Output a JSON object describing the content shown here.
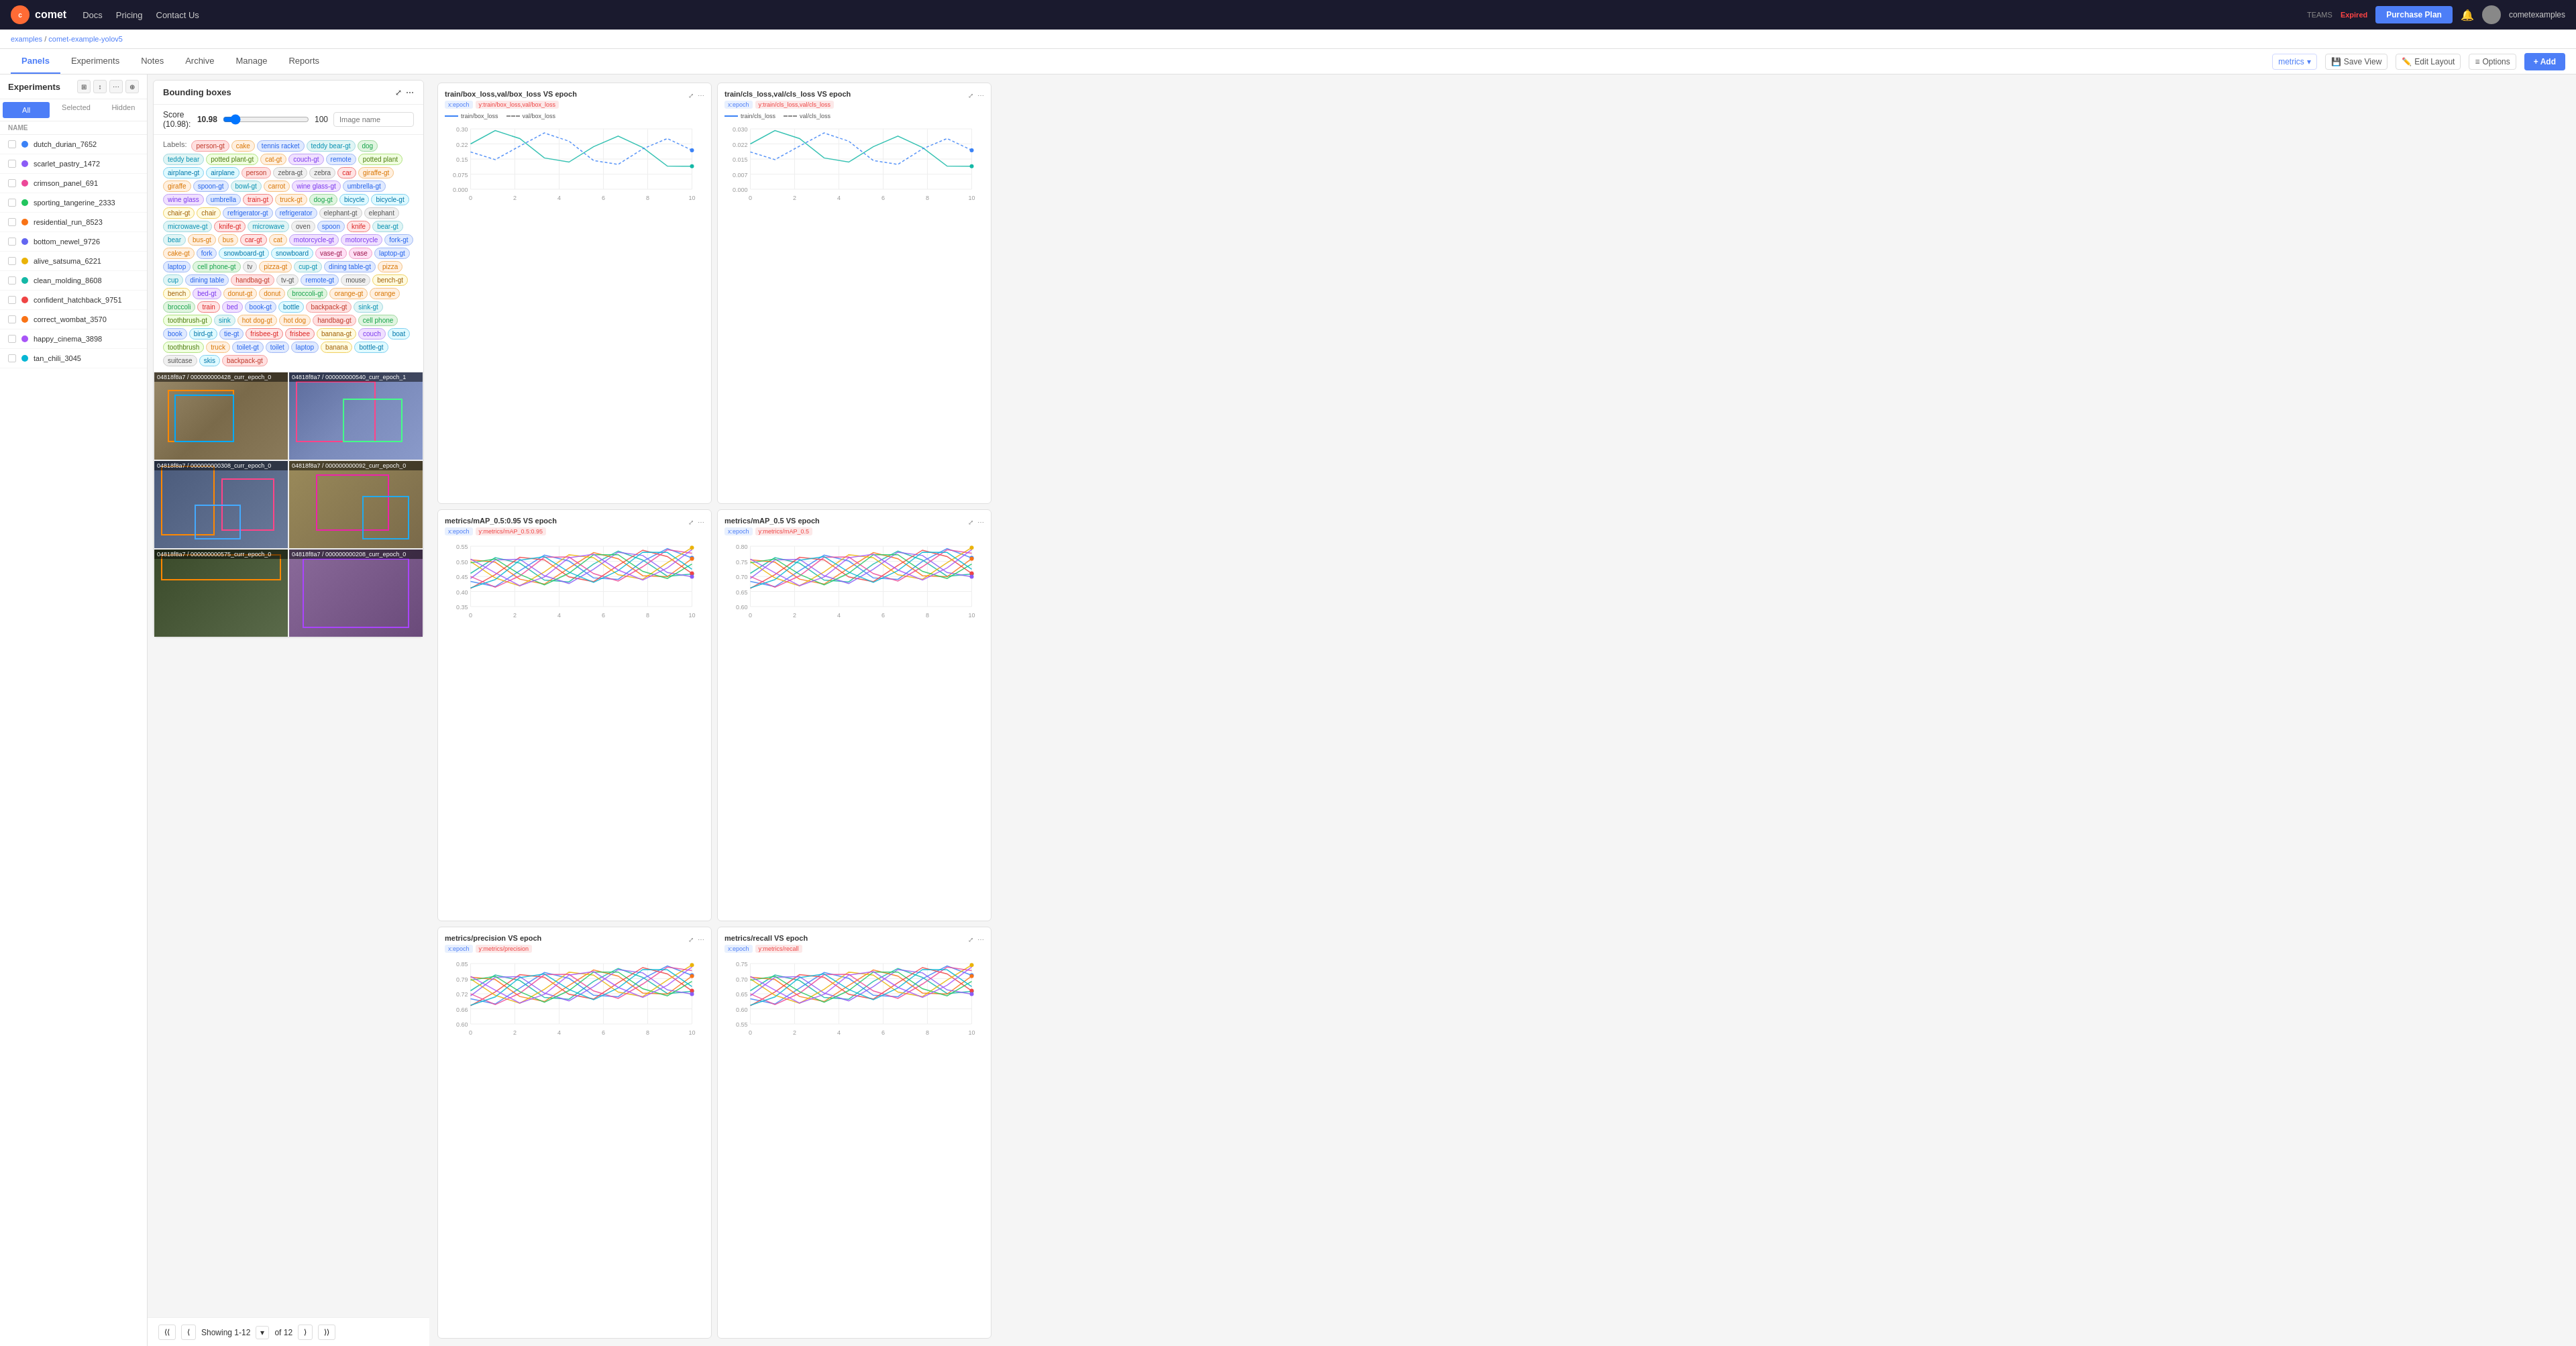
{
  "navbar": {
    "logo": "comet",
    "links": [
      "Docs",
      "Pricing",
      "Contact Us"
    ],
    "teams_label": "TEAMS",
    "expired": "Expired",
    "purchase_btn": "Purchase Plan",
    "user": "cometexamples"
  },
  "breadcrumb": {
    "parent": "examples",
    "child": "comet-example-yolov5"
  },
  "tabs": {
    "items": [
      "Panels",
      "Experiments",
      "Notes",
      "Archive",
      "Manage",
      "Reports"
    ],
    "active": "Panels"
  },
  "toolbar": {
    "metrics": "metrics",
    "save_view": "Save View",
    "edit_layout": "Edit Layout",
    "options": "Options",
    "add": "+ Add"
  },
  "sidebar": {
    "title": "Experiments",
    "filter_tabs": [
      "All",
      "Selected",
      "Hidden"
    ],
    "active_filter": "All",
    "col_header": "NAME",
    "experiments": [
      {
        "name": "dutch_durian_7652",
        "color": "#3b82f6"
      },
      {
        "name": "scarlet_pastry_1472",
        "color": "#8b5cf6"
      },
      {
        "name": "crimson_panel_691",
        "color": "#ec4899"
      },
      {
        "name": "sporting_tangerine_2333",
        "color": "#22c55e"
      },
      {
        "name": "residential_run_8523",
        "color": "#f97316"
      },
      {
        "name": "bottom_newel_9726",
        "color": "#6366f1"
      },
      {
        "name": "alive_satsuma_6221",
        "color": "#eab308"
      },
      {
        "name": "clean_molding_8608",
        "color": "#14b8a6"
      },
      {
        "name": "confident_hatchback_9751",
        "color": "#ef4444"
      },
      {
        "name": "correct_wombat_3570",
        "color": "#f97316"
      },
      {
        "name": "happy_cinema_3898",
        "color": "#a855f7"
      },
      {
        "name": "tan_chili_3045",
        "color": "#06b6d4"
      }
    ]
  },
  "bb_panel": {
    "title": "Bounding boxes",
    "score_label": "Score (10.98):",
    "score_value": "10.98",
    "score_max": "100",
    "image_name_placeholder": "Image name",
    "labels": [
      {
        "text": "person-gt",
        "style": "pink"
      },
      {
        "text": "cake",
        "style": "orange"
      },
      {
        "text": "tennis racket",
        "style": "blue"
      },
      {
        "text": "teddy bear-gt",
        "style": "teal"
      },
      {
        "text": "dog",
        "style": "green"
      },
      {
        "text": "teddy bear",
        "style": "teal"
      },
      {
        "text": "potted plant-gt",
        "style": "lime"
      },
      {
        "text": "cat-gt",
        "style": "orange"
      },
      {
        "text": "couch-gt",
        "style": "purple"
      },
      {
        "text": "remote",
        "style": "blue"
      },
      {
        "text": "potted plant",
        "style": "lime"
      },
      {
        "text": "airplane-gt",
        "style": "cyan"
      },
      {
        "text": "airplane",
        "style": "cyan"
      },
      {
        "text": "person",
        "style": "pink"
      },
      {
        "text": "zebra-gt",
        "style": "gray"
      },
      {
        "text": "zebra",
        "style": "gray"
      },
      {
        "text": "car",
        "style": "red"
      },
      {
        "text": "giraffe-gt",
        "style": "orange"
      },
      {
        "text": "giraffe",
        "style": "orange"
      },
      {
        "text": "spoon-gt",
        "style": "blue"
      },
      {
        "text": "bowl-gt",
        "style": "teal"
      },
      {
        "text": "carrot",
        "style": "orange"
      },
      {
        "text": "wine glass-gt",
        "style": "purple"
      },
      {
        "text": "umbrella-gt",
        "style": "blue"
      },
      {
        "text": "wine glass",
        "style": "purple"
      },
      {
        "text": "umbrella",
        "style": "blue"
      },
      {
        "text": "train-gt",
        "style": "red"
      },
      {
        "text": "truck-gt",
        "style": "orange"
      },
      {
        "text": "dog-gt",
        "style": "green"
      },
      {
        "text": "bicycle",
        "style": "cyan"
      },
      {
        "text": "bicycle-gt",
        "style": "cyan"
      },
      {
        "text": "chair-gt",
        "style": "yellow"
      },
      {
        "text": "chair",
        "style": "yellow"
      },
      {
        "text": "refrigerator-gt",
        "style": "blue"
      },
      {
        "text": "refrigerator",
        "style": "blue"
      },
      {
        "text": "elephant-gt",
        "style": "gray"
      },
      {
        "text": "elephant",
        "style": "gray"
      },
      {
        "text": "microwave-gt",
        "style": "teal"
      },
      {
        "text": "knife-gt",
        "style": "red"
      },
      {
        "text": "microwave",
        "style": "teal"
      },
      {
        "text": "oven",
        "style": "gray"
      },
      {
        "text": "spoon",
        "style": "blue"
      },
      {
        "text": "knife",
        "style": "red"
      },
      {
        "text": "bear-gt",
        "style": "teal"
      },
      {
        "text": "bear",
        "style": "teal"
      },
      {
        "text": "bus-gt",
        "style": "orange"
      },
      {
        "text": "bus",
        "style": "orange"
      },
      {
        "text": "car-gt",
        "style": "red"
      },
      {
        "text": "cat",
        "style": "orange"
      },
      {
        "text": "motorcycle-gt",
        "style": "purple"
      },
      {
        "text": "motorcycle",
        "style": "purple"
      },
      {
        "text": "fork-gt",
        "style": "blue"
      },
      {
        "text": "cake-gt",
        "style": "orange"
      },
      {
        "text": "fork",
        "style": "blue"
      },
      {
        "text": "snowboard-gt",
        "style": "cyan"
      },
      {
        "text": "snowboard",
        "style": "cyan"
      },
      {
        "text": "vase-gt",
        "style": "magenta"
      },
      {
        "text": "vase",
        "style": "magenta"
      },
      {
        "text": "laptop-gt",
        "style": "blue"
      },
      {
        "text": "laptop",
        "style": "blue"
      },
      {
        "text": "cell phone-gt",
        "style": "green"
      },
      {
        "text": "tv",
        "style": "gray"
      },
      {
        "text": "pizza-gt",
        "style": "orange"
      },
      {
        "text": "cup-gt",
        "style": "teal"
      },
      {
        "text": "dining table-gt",
        "style": "blue"
      },
      {
        "text": "pizza",
        "style": "orange"
      },
      {
        "text": "cup",
        "style": "teal"
      },
      {
        "text": "dining table",
        "style": "blue"
      },
      {
        "text": "handbag-gt",
        "style": "pink"
      },
      {
        "text": "tv-gt",
        "style": "gray"
      },
      {
        "text": "remote-gt",
        "style": "blue"
      },
      {
        "text": "mouse",
        "style": "gray"
      },
      {
        "text": "bench-gt",
        "style": "yellow"
      },
      {
        "text": "bench",
        "style": "yellow"
      },
      {
        "text": "bed-gt",
        "style": "purple"
      },
      {
        "text": "donut-gt",
        "style": "orange"
      },
      {
        "text": "donut",
        "style": "orange"
      },
      {
        "text": "broccoli-gt",
        "style": "green"
      },
      {
        "text": "orange-gt",
        "style": "orange"
      },
      {
        "text": "orange",
        "style": "orange"
      },
      {
        "text": "broccoli",
        "style": "green"
      },
      {
        "text": "train",
        "style": "red"
      },
      {
        "text": "bed",
        "style": "purple"
      },
      {
        "text": "book-gt",
        "style": "blue"
      },
      {
        "text": "bottle",
        "style": "cyan"
      },
      {
        "text": "backpack-gt",
        "style": "pink"
      },
      {
        "text": "sink-gt",
        "style": "teal"
      },
      {
        "text": "toothbrush-gt",
        "style": "lime"
      },
      {
        "text": "sink",
        "style": "teal"
      },
      {
        "text": "hot dog-gt",
        "style": "orange"
      },
      {
        "text": "hot dog",
        "style": "orange"
      },
      {
        "text": "handbag-gt",
        "style": "pink"
      },
      {
        "text": "cell phone",
        "style": "green"
      },
      {
        "text": "book",
        "style": "blue"
      },
      {
        "text": "bird-gt",
        "style": "cyan"
      },
      {
        "text": "tie-gt",
        "style": "blue"
      },
      {
        "text": "frisbee-gt",
        "style": "red"
      },
      {
        "text": "frisbee",
        "style": "red"
      },
      {
        "text": "banana-gt",
        "style": "yellow"
      },
      {
        "text": "couch",
        "style": "purple"
      },
      {
        "text": "boat",
        "style": "cyan"
      },
      {
        "text": "toothbrush",
        "style": "lime"
      },
      {
        "text": "truck",
        "style": "orange"
      },
      {
        "text": "toilet-gt",
        "style": "blue"
      },
      {
        "text": "toilet",
        "style": "blue"
      },
      {
        "text": "laptop",
        "style": "blue"
      },
      {
        "text": "banana",
        "style": "yellow"
      },
      {
        "text": "bottle-gt",
        "style": "cyan"
      },
      {
        "text": "suitcase",
        "style": "gray"
      },
      {
        "text": "skis",
        "style": "cyan"
      },
      {
        "text": "backpack-gt",
        "style": "pink"
      }
    ],
    "images": [
      {
        "id": "04818f8a7 / 000000000428_curr_epoch_0",
        "bg": "#7a8a6a"
      },
      {
        "id": "04818f8a7 / 000000000540_curr_epoch_1",
        "bg": "#6a7a8a"
      },
      {
        "id": "04818f8a7 / 000000000308_curr_epoch_0",
        "bg": "#5a6a7a"
      },
      {
        "id": "04818f8a7 / 000000000092_curr_epoch_0",
        "bg": "#8a7a5a"
      },
      {
        "id": "04818f8a7 / 000000000575_curr_epoch_0",
        "bg": "#6a8a7a"
      },
      {
        "id": "04818f8a7 / 000000000208_curr_epoch_0",
        "bg": "#7a6a8a"
      }
    ]
  },
  "charts": [
    {
      "title": "train/box_loss,val/box_loss VS epoch",
      "tags": [
        "x:epoch",
        "y:train/box_loss,val/box_loss"
      ],
      "legend": [
        {
          "label": "train/box_loss",
          "color": "#3b82f6",
          "dashed": false
        },
        {
          "label": "val/box_loss",
          "color": "#888",
          "dashed": true
        }
      ],
      "y_max": 0.3,
      "y_min": 0
    },
    {
      "title": "train/cls_loss,val/cls_loss VS epoch",
      "tags": [
        "x:epoch",
        "y:train/cls_loss,val/cls_loss"
      ],
      "legend": [
        {
          "label": "train/cls_loss",
          "color": "#3b82f6",
          "dashed": false
        },
        {
          "label": "val/cls_loss",
          "color": "#888",
          "dashed": true
        }
      ],
      "y_max": 0.03,
      "y_min": 0
    },
    {
      "title": "metrics/mAP_0.5:0.95 VS epoch",
      "tags": [
        "x:epoch",
        "y:metrics/mAP_0.5:0.95"
      ],
      "legend": [],
      "y_max": 0.55,
      "y_min": 0.35
    },
    {
      "title": "metrics/mAP_0.5 VS epoch",
      "tags": [
        "x:epoch",
        "y:metrics/mAP_0.5"
      ],
      "legend": [],
      "y_max": 0.8,
      "y_min": 0.6
    },
    {
      "title": "metrics/precision VS epoch",
      "tags": [
        "x:epoch",
        "y:metrics/precision"
      ],
      "legend": [],
      "y_max": 0.85,
      "y_min": 0.6
    },
    {
      "title": "metrics/recall VS epoch",
      "tags": [
        "x:epoch",
        "y:metrics/recall"
      ],
      "legend": [],
      "y_max": 0.75,
      "y_min": 0.55
    }
  ],
  "pagination": {
    "showing": "Showing 1-12",
    "of": "of 12",
    "page": "1"
  }
}
